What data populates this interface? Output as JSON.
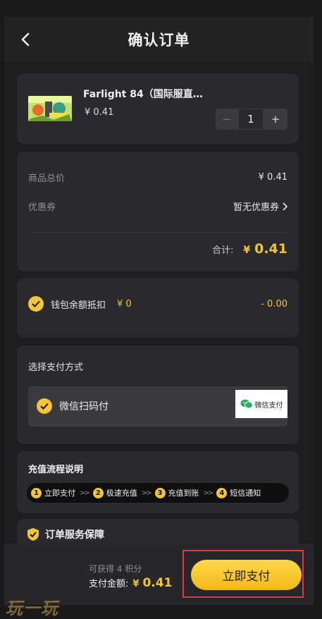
{
  "header": {
    "title": "确认订单"
  },
  "product": {
    "name": "Farlight 84（国际服直…",
    "price": "¥ 0.41",
    "quantity": "1",
    "minus": "−",
    "plus": "+"
  },
  "pricing": {
    "total_label": "商品总价",
    "total_value": "¥ 0.41",
    "coupon_label": "优惠券",
    "coupon_value": "暂无优惠券",
    "sum_label": "合计:",
    "sum_currency": "¥",
    "sum_value": "0.41"
  },
  "wallet": {
    "label": "钱包余额抵扣",
    "balance": "¥ 0",
    "deduction": "- 0.00"
  },
  "payment": {
    "title": "选择支付方式",
    "method": "微信扫码付",
    "logo_text": "微信支付"
  },
  "flow": {
    "title": "充值流程说明",
    "steps": [
      {
        "num": "1",
        "label": "立即支付"
      },
      {
        "num": "2",
        "label": "极速充值"
      },
      {
        "num": "3",
        "label": "充值到账"
      },
      {
        "num": "4",
        "label": "短信通知"
      }
    ],
    "separator": ">>"
  },
  "guarantee": {
    "title": "订单服务保障"
  },
  "bottom": {
    "points": "可获得 4 积分",
    "amount_label": "支付金额:",
    "amount_currency": "¥",
    "amount_value": "0.41",
    "pay_button": "立即支付"
  },
  "watermark": "玩一玩",
  "colors": {
    "accent": "#f2c53d",
    "background": "#1e1e21",
    "card": "#2a2a2e",
    "highlight": "#e0383a",
    "wechat_green": "#2aae67"
  },
  "icons": [
    "back-icon",
    "check-icon",
    "shield-check-icon",
    "wechat-pay-icon",
    "chevron-right-icon"
  ]
}
